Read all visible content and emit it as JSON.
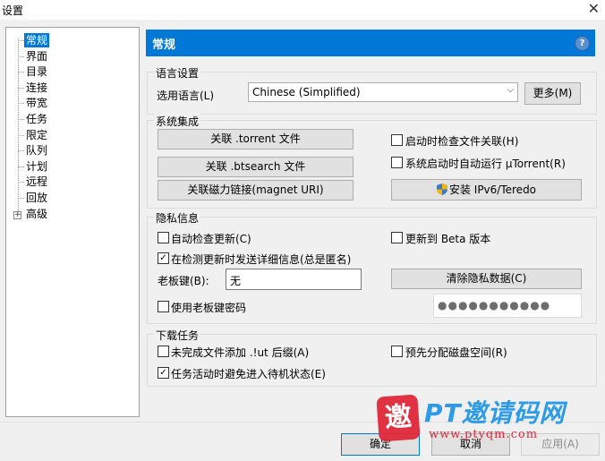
{
  "window": {
    "title": "设置",
    "close_glyph": "✕"
  },
  "tree": {
    "items": [
      "常规",
      "界面",
      "目录",
      "连接",
      "带宽",
      "任务",
      "限定",
      "队列",
      "计划",
      "远程",
      "回放",
      "高级"
    ],
    "selected": "常规",
    "expander_glyph": "+"
  },
  "header": {
    "title": "常规",
    "help_glyph": "?"
  },
  "language": {
    "group_title": "语言设置",
    "select_label": "选用语言(L)",
    "selected_value": "Chinese (Simplified)",
    "more_button": "更多(M)"
  },
  "integration": {
    "group_title": "系统集成",
    "assoc_torrent": "关联 .torrent 文件",
    "assoc_btsearch": "关联 .btsearch 文件",
    "assoc_magnet": "关联磁力链接(magnet URI)",
    "check_assoc_label": "启动时检查文件关联(H)",
    "check_assoc_checked": false,
    "autostart_label": "系统启动时自动运行 µTorrent(R)",
    "autostart_checked": false,
    "ipv6_button": "安装 IPv6/Teredo"
  },
  "privacy": {
    "group_title": "隐私信息",
    "auto_update_label": "自动检查更新(C)",
    "auto_update_checked": false,
    "beta_label": "更新到 Beta 版本",
    "beta_checked": false,
    "send_info_label": "在检测更新时发送详细信息(总是匿名)",
    "send_info_checked": true,
    "boss_key_label": "老板键(B):",
    "boss_key_value": "无",
    "clear_button": "清除隐私数据(C)",
    "boss_pwd_label": "使用老板键密码",
    "boss_pwd_checked": false,
    "password_mask": "●●●●●●●●●●●"
  },
  "download": {
    "group_title": "下载任务",
    "append_ut_label": "未完成文件添加 .!ut 后缀(A)",
    "append_ut_checked": false,
    "prealloc_label": "预先分配磁盘空间(R)",
    "prealloc_checked": false,
    "standby_label": "任务活动时避免进入待机状态(E)",
    "standby_checked": true
  },
  "buttons": {
    "ok": "确定",
    "cancel": "取消",
    "apply": "应用(A)"
  },
  "check_glyph": "✓",
  "watermark": {
    "seal": "邀",
    "text": "PT邀请码网",
    "url": "www.ptyqm.com"
  },
  "colors": {
    "accent": "#0078d7",
    "watermark_blue": "#2e9be8",
    "watermark_red": "#e0283a"
  }
}
